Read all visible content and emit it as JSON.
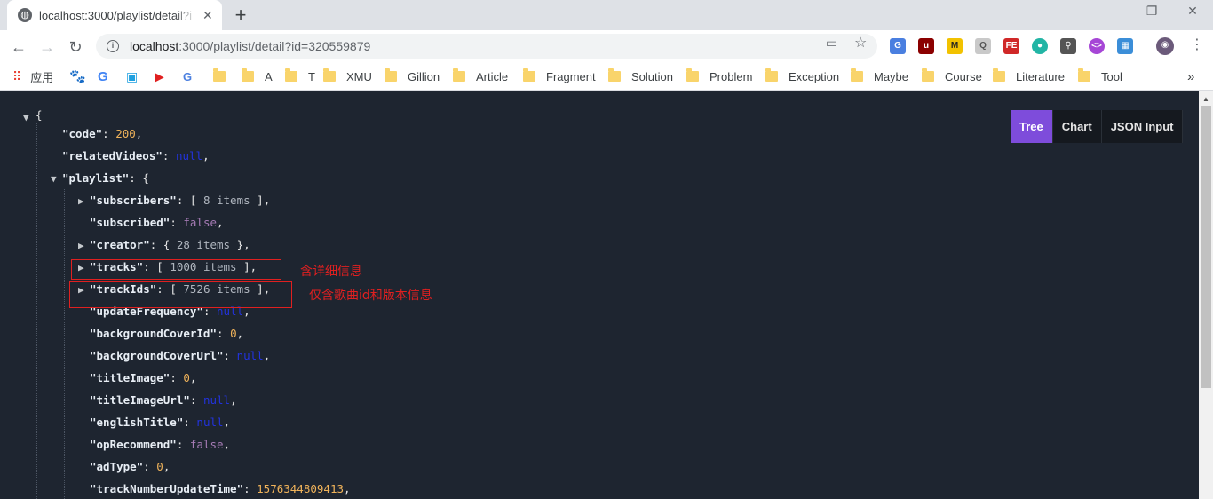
{
  "browser": {
    "tab_title": "localhost:3000/playlist/detail?i",
    "tab_close": "✕",
    "new_tab": "+",
    "url_host": "localhost",
    "url_rest": ":3000/playlist/detail?id=320559879",
    "win_min": "—",
    "win_restore": "❐",
    "win_close": "✕"
  },
  "bookmarks": {
    "apps_label": "应用",
    "items": [
      "A",
      "T",
      "XMU",
      "Gillion",
      "Article",
      "Fragment",
      "Solution",
      "Problem",
      "Exception",
      "Maybe",
      "Course",
      "Literature",
      "Tool"
    ],
    "more": "»"
  },
  "view_tabs": {
    "tree": "Tree",
    "chart": "Chart",
    "json_input": "JSON Input"
  },
  "json": {
    "open_brace": "{",
    "code_key": "\"code\"",
    "code_val": "200",
    "relatedVideos_key": "\"relatedVideos\"",
    "relatedVideos_val": "null",
    "playlist_key": "\"playlist\"",
    "subscribers_key": "\"subscribers\"",
    "subscribers_meta": "8 items",
    "subscribed_key": "\"subscribed\"",
    "subscribed_val": "false",
    "creator_key": "\"creator\"",
    "creator_meta": "28 items",
    "tracks_key": "\"tracks\"",
    "tracks_meta": "1000 items",
    "trackIds_key": "\"trackIds\"",
    "trackIds_meta": "7526 items",
    "updateFrequency_key": "\"updateFrequency\"",
    "updateFrequency_val": "null",
    "backgroundCoverId_key": "\"backgroundCoverId\"",
    "backgroundCoverId_val": "0",
    "backgroundCoverUrl_key": "\"backgroundCoverUrl\"",
    "backgroundCoverUrl_val": "null",
    "titleImage_key": "\"titleImage\"",
    "titleImage_val": "0",
    "titleImageUrl_key": "\"titleImageUrl\"",
    "titleImageUrl_val": "null",
    "englishTitle_key": "\"englishTitle\"",
    "englishTitle_val": "null",
    "opRecommend_key": "\"opRecommend\"",
    "opRecommend_val": "false",
    "adType_key": "\"adType\"",
    "adType_val": "0",
    "trackNumberUpdateTime_key": "\"trackNumberUpdateTime\"",
    "trackNumberUpdateTime_val": "1576344809413"
  },
  "annotations": {
    "tracks_note": "含详细信息",
    "trackIds_note": "仅含歌曲id和版本信息"
  }
}
